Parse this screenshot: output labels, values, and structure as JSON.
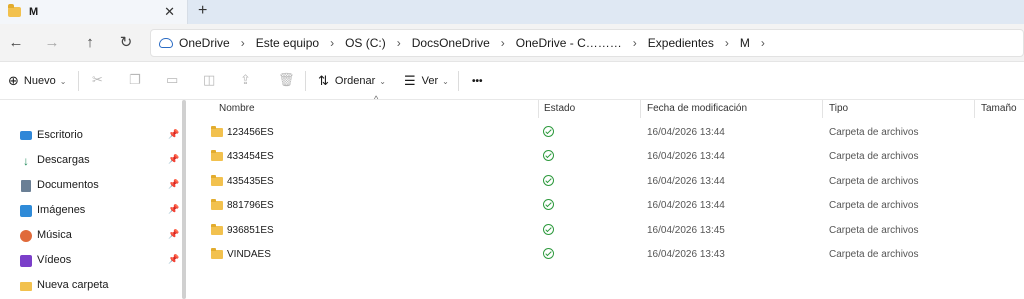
{
  "tab": {
    "title": "M",
    "close": "✕",
    "new": "+"
  },
  "nav": {
    "back": "←",
    "forward": "→",
    "up": "↑",
    "refresh": "↻"
  },
  "breadcrumbs": [
    "OneDrive",
    "Este equipo",
    "OS (C:)",
    "DocsOneDrive",
    "OneDrive - C………",
    "Expedientes",
    "M"
  ],
  "toolbar": {
    "new_label": "Nuevo",
    "sort_label": "Ordenar",
    "view_label": "Ver",
    "more_label": "•••"
  },
  "sidebar": {
    "items": [
      {
        "label": "Escritorio",
        "icon": "desktop-icon",
        "color": "#2f87d8",
        "pinned": true
      },
      {
        "label": "Descargas",
        "icon": "download-icon",
        "color": "#1f8a5c",
        "pinned": true
      },
      {
        "label": "Documentos",
        "icon": "documents-icon",
        "color": "#6a7f95",
        "pinned": true
      },
      {
        "label": "Imágenes",
        "icon": "pictures-icon",
        "color": "#2f8bd8",
        "pinned": true
      },
      {
        "label": "Música",
        "icon": "music-icon",
        "color": "#e06a3a",
        "pinned": true
      },
      {
        "label": "Vídeos",
        "icon": "videos-icon",
        "color": "#7b3fc9",
        "pinned": true
      },
      {
        "label": "Nueva carpeta",
        "icon": "folder-icon",
        "color": "#f2c14e",
        "pinned": false
      }
    ]
  },
  "columns": [
    "Nombre",
    "Estado",
    "Fecha de modificación",
    "Tipo",
    "Tamaño"
  ],
  "files": [
    {
      "name": "123456ES",
      "date": "16/04/2026 13:44",
      "type": "Carpeta de archivos"
    },
    {
      "name": "433454ES",
      "date": "16/04/2026 13:44",
      "type": "Carpeta de archivos"
    },
    {
      "name": "435435ES",
      "date": "16/04/2026 13:44",
      "type": "Carpeta de archivos"
    },
    {
      "name": "881796ES",
      "date": "16/04/2026 13:44",
      "type": "Carpeta de archivos"
    },
    {
      "name": "936851ES",
      "date": "16/04/2026 13:45",
      "type": "Carpeta de archivos"
    },
    {
      "name": "VINDAES",
      "date": "16/04/2026 13:43",
      "type": "Carpeta de archivos"
    }
  ]
}
